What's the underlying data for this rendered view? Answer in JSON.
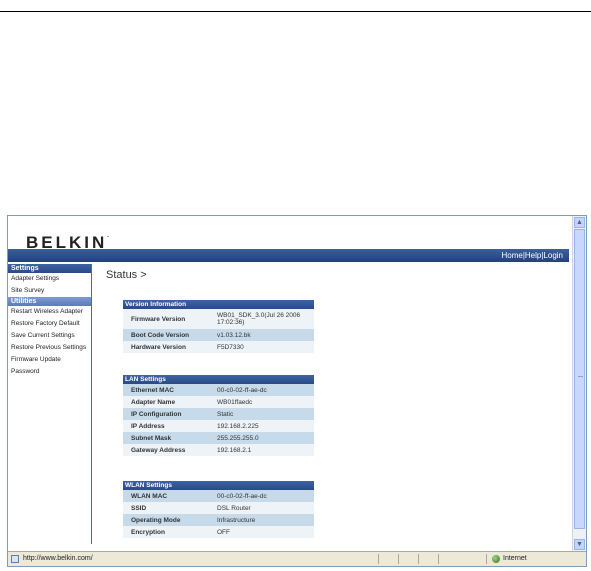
{
  "header": {
    "brand": "BELKIN",
    "links": [
      "Home",
      "Help",
      "Login"
    ]
  },
  "sidebar": {
    "sections": [
      {
        "title": "Settings",
        "items": [
          "Adapter Settings",
          "Site Survey"
        ]
      },
      {
        "title": "Utilities",
        "items": [
          "Restart Wireless Adapter",
          "Restore Factory Default",
          "Save Current Settings",
          "Restore Previous Settings",
          "Firmware Update",
          "Password"
        ]
      }
    ]
  },
  "main": {
    "title": "Status >",
    "version": {
      "heading": "Version Information",
      "rows": [
        {
          "label": "Firmware Version",
          "value": "WB01_SDK_3.0(Jul 26 2006 17:02:36)"
        },
        {
          "label": "Boot Code Version",
          "value": "v1.03.12.bk"
        },
        {
          "label": "Hardware Version",
          "value": "F5D7330"
        }
      ]
    },
    "lan": {
      "heading": "LAN Settings",
      "rows": [
        {
          "label": "Ethernet MAC",
          "value": "00-c0-02-ff-ae-dc"
        },
        {
          "label": "Adapter Name",
          "value": "WB01ffaedc"
        },
        {
          "label": "IP Configuration",
          "value": "Static"
        },
        {
          "label": "IP Address",
          "value": "192.168.2.225"
        },
        {
          "label": "Subnet Mask",
          "value": "255.255.255.0"
        },
        {
          "label": "Gateway Address",
          "value": "192.168.2.1"
        }
      ]
    },
    "wlan": {
      "heading": "WLAN Settings",
      "rows": [
        {
          "label": "WLAN MAC",
          "value": "00-c0-02-ff-ae-dc"
        },
        {
          "label": "SSID",
          "value": "DSL Router"
        },
        {
          "label": "Operating Mode",
          "value": "Infrastructure"
        },
        {
          "label": "Encryption",
          "value": "OFF"
        }
      ]
    }
  },
  "statusbar": {
    "url": "http://www.belkin.com/",
    "zone": "Internet"
  },
  "colors": {
    "header_bar": "#2a4a86",
    "row_alt": "#c6dae9"
  }
}
